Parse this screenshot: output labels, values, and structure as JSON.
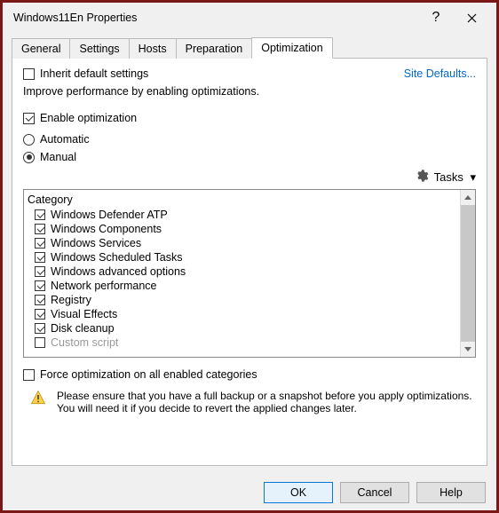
{
  "titlebar": {
    "title": "Windows11En Properties"
  },
  "tabs": [
    "General",
    "Settings",
    "Hosts",
    "Preparation",
    "Optimization"
  ],
  "active_tab": 4,
  "inherit": {
    "label": "Inherit default settings",
    "checked": false
  },
  "site_defaults": "Site Defaults...",
  "description": "Improve performance by enabling optimizations.",
  "enable_opt": {
    "label": "Enable optimization",
    "checked": true
  },
  "mode": {
    "automatic": {
      "label": "Automatic",
      "checked": false
    },
    "manual": {
      "label": "Manual",
      "checked": true
    }
  },
  "tasks_label": "Tasks",
  "list": {
    "header": "Category",
    "items": [
      {
        "label": "Windows Defender ATP",
        "checked": true
      },
      {
        "label": "Windows Components",
        "checked": true
      },
      {
        "label": "Windows Services",
        "checked": true
      },
      {
        "label": "Windows Scheduled Tasks",
        "checked": true
      },
      {
        "label": "Windows advanced options",
        "checked": true
      },
      {
        "label": "Network performance",
        "checked": true
      },
      {
        "label": "Registry",
        "checked": true
      },
      {
        "label": "Visual Effects",
        "checked": true
      },
      {
        "label": "Disk cleanup",
        "checked": true
      },
      {
        "label": "Custom script",
        "checked": false,
        "cut": true
      }
    ]
  },
  "force": {
    "label": "Force optimization on all enabled categories",
    "checked": false
  },
  "warning": "Please ensure that you have a full backup or a snapshot before you apply optimizations. You will need it if you decide to revert the applied changes later.",
  "buttons": {
    "ok": "OK",
    "cancel": "Cancel",
    "help": "Help"
  }
}
